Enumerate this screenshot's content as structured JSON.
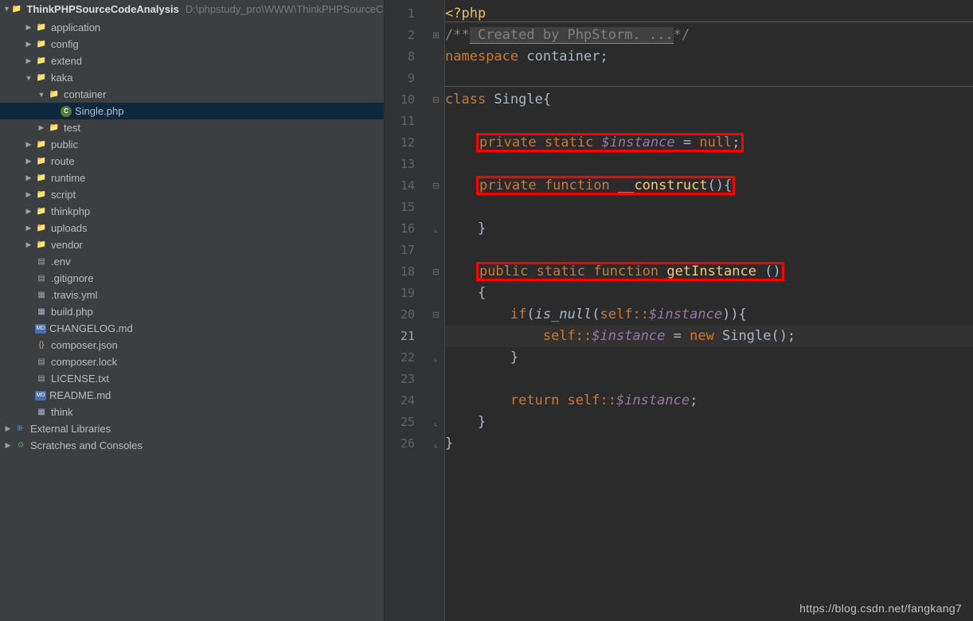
{
  "project": {
    "name": "ThinkPHPSourceCodeAnalysis",
    "path": "D:\\phpstudy_pro\\WWW\\ThinkPHPSourceCo"
  },
  "tree": [
    {
      "indent": 1,
      "twisty": "closed",
      "icon": "folder",
      "label": "application",
      "sel": false
    },
    {
      "indent": 1,
      "twisty": "closed",
      "icon": "folder",
      "label": "config",
      "sel": false
    },
    {
      "indent": 1,
      "twisty": "closed",
      "icon": "folder",
      "label": "extend",
      "sel": false
    },
    {
      "indent": 1,
      "twisty": "open",
      "icon": "folder",
      "label": "kaka",
      "sel": false
    },
    {
      "indent": 2,
      "twisty": "open",
      "icon": "folder",
      "label": "container",
      "sel": false
    },
    {
      "indent": 3,
      "twisty": "",
      "icon": "php",
      "label": "Single.php",
      "sel": true
    },
    {
      "indent": 2,
      "twisty": "closed",
      "icon": "folder",
      "label": "test",
      "sel": false
    },
    {
      "indent": 1,
      "twisty": "closed",
      "icon": "folder",
      "label": "public",
      "sel": false
    },
    {
      "indent": 1,
      "twisty": "closed",
      "icon": "folder",
      "label": "route",
      "sel": false
    },
    {
      "indent": 1,
      "twisty": "closed",
      "icon": "folder",
      "label": "runtime",
      "sel": false
    },
    {
      "indent": 1,
      "twisty": "closed",
      "icon": "folder",
      "label": "script",
      "sel": false
    },
    {
      "indent": 1,
      "twisty": "closed",
      "icon": "folder",
      "label": "thinkphp",
      "sel": false
    },
    {
      "indent": 1,
      "twisty": "closed",
      "icon": "folder",
      "label": "uploads",
      "sel": false
    },
    {
      "indent": 1,
      "twisty": "closed",
      "icon": "folder",
      "label": "vendor",
      "sel": false
    },
    {
      "indent": 1,
      "twisty": "",
      "icon": "txt",
      "label": ".env",
      "sel": false
    },
    {
      "indent": 1,
      "twisty": "",
      "icon": "txt",
      "label": ".gitignore",
      "sel": false
    },
    {
      "indent": 1,
      "twisty": "",
      "icon": "yml",
      "label": ".travis.yml",
      "sel": false
    },
    {
      "indent": 1,
      "twisty": "",
      "icon": "php2",
      "label": "build.php",
      "sel": false
    },
    {
      "indent": 1,
      "twisty": "",
      "icon": "md",
      "label": "CHANGELOG.md",
      "sel": false
    },
    {
      "indent": 1,
      "twisty": "",
      "icon": "json",
      "label": "composer.json",
      "sel": false
    },
    {
      "indent": 1,
      "twisty": "",
      "icon": "file",
      "label": "composer.lock",
      "sel": false
    },
    {
      "indent": 1,
      "twisty": "",
      "icon": "txt",
      "label": "LICENSE.txt",
      "sel": false
    },
    {
      "indent": 1,
      "twisty": "",
      "icon": "md",
      "label": "README.md",
      "sel": false
    },
    {
      "indent": 1,
      "twisty": "",
      "icon": "php2",
      "label": "think",
      "sel": false
    }
  ],
  "tree_bottom": [
    {
      "indent": 0,
      "twisty": "closed",
      "icon": "lib",
      "label": "External Libraries"
    },
    {
      "indent": 0,
      "twisty": "closed",
      "icon": "scratch",
      "label": "Scratches and Consoles"
    }
  ],
  "line_numbers": [
    "1",
    "2",
    "8",
    "9",
    "10",
    "11",
    "12",
    "13",
    "14",
    "15",
    "16",
    "17",
    "18",
    "19",
    "20",
    "21",
    "22",
    "23",
    "24",
    "25",
    "26"
  ],
  "current_line": "21",
  "fold_marks": {
    "1": "",
    "2": "plus",
    "8": "",
    "9": "",
    "10": "open",
    "11": "",
    "12": "",
    "13": "",
    "14": "open",
    "15": "",
    "16": "close",
    "17": "",
    "18": "open",
    "19": "",
    "20": "open",
    "21": "",
    "22": "close",
    "23": "",
    "24": "",
    "25": "close",
    "26": "close"
  },
  "code": {
    "l1": {
      "open": "<?php"
    },
    "l2": {
      "c1": "/**",
      "c2": " Created by PhpStorm. ...",
      "c3": "*/"
    },
    "l8": {
      "kw": "namespace ",
      "ns": "container;"
    },
    "l10": {
      "kw": "class ",
      "name": "Single{"
    },
    "l12": {
      "p": "private ",
      "s": "static ",
      "v": "$instance",
      "eq": " = ",
      "n": "null",
      "sc": ";"
    },
    "l14": {
      "p": "private ",
      "f": "function ",
      "fn": "__construct",
      "pr": "(){"
    },
    "l16": {
      "b": "}"
    },
    "l18": {
      "p": "public ",
      "s": "static ",
      "f": "function ",
      "fn": "getInstance ",
      "pr": "()"
    },
    "l19": {
      "b": "{"
    },
    "l20": {
      "if": "if",
      "p1": "(",
      "isn": "is_null",
      "p2": "(",
      "slf": "self::",
      "v": "$instance",
      "p3": ")){"
    },
    "l21": {
      "slf": "self::",
      "v": "$instance",
      "eq": " = ",
      "nw": "new ",
      "cls": "Single();"
    },
    "l22": {
      "b": "}"
    },
    "l24": {
      "ret": "return ",
      "slf": "self::",
      "v": "$instance",
      "sc": ";"
    },
    "l25": {
      "b": "}"
    },
    "l26": {
      "b": "}"
    }
  },
  "watermark": "https://blog.csdn.net/fangkang7"
}
